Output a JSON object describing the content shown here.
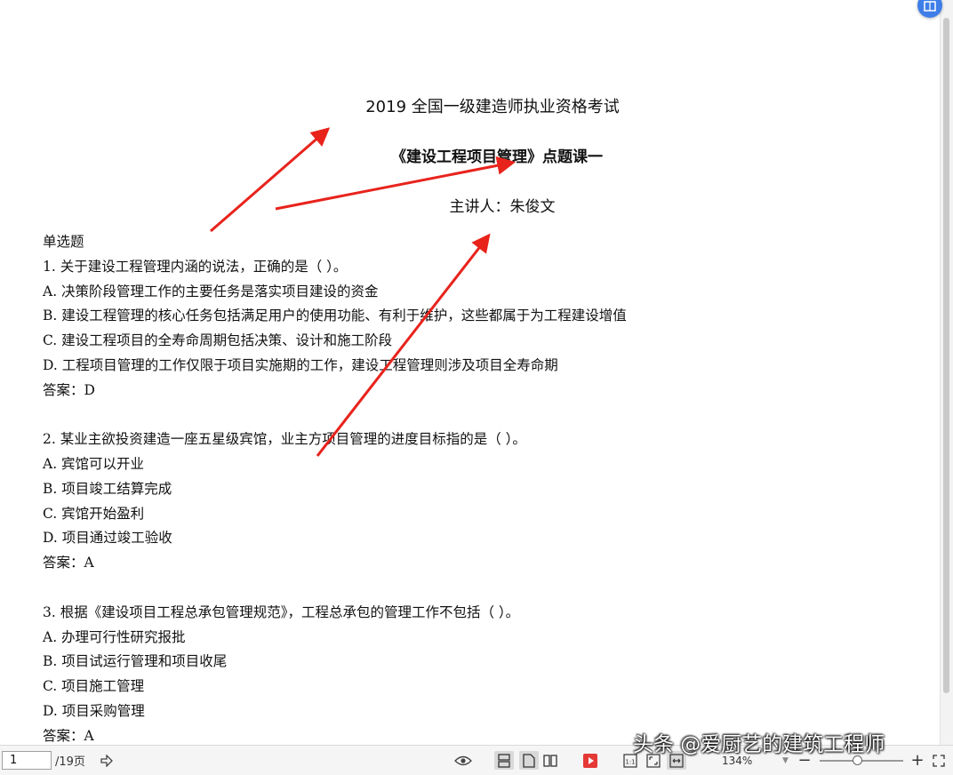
{
  "document": {
    "title": "2019 全国一级建造师执业资格考试",
    "subtitle": "《建设工程项目管理》点题课一",
    "lecturer": "主讲人：朱俊文",
    "section": "单选题",
    "questions": [
      {
        "stem": "1. 关于建设工程管理内涵的说法，正确的是（ ）。",
        "options": [
          "A. 决策阶段管理工作的主要任务是落实项目建设的资金",
          "B. 建设工程管理的核心任务包括满足用户的使用功能、有利于维护，这些都属于为工程建设增值",
          "C. 建设工程项目的全寿命周期包括决策、设计和施工阶段",
          "D. 工程项目管理的工作仅限于项目实施期的工作，建设工程管理则涉及项目全寿命期"
        ],
        "answer": "答案：D"
      },
      {
        "stem": "2. 某业主欲投资建造一座五星级宾馆，业主方项目管理的进度目标指的是（ ）。",
        "options": [
          "A. 宾馆可以开业",
          "B. 项目竣工结算完成",
          "C. 宾馆开始盈利",
          "D. 项目通过竣工验收"
        ],
        "answer": "答案：A"
      },
      {
        "stem": "3. 根据《建设项目工程总承包管理规范》，工程总承包的管理工作不包括（ ）。",
        "options": [
          "A. 办理可行性研究报批",
          "B. 项目试运行管理和项目收尾",
          "C. 项目施工管理",
          "D. 项目采购管理"
        ],
        "answer": "答案：A"
      }
    ]
  },
  "annotation_color": "#e8231c",
  "statusbar": {
    "current_page": "1",
    "total_pages": "/19页",
    "zoom": "134%",
    "zoom_fraction": 0.45
  },
  "icons": {
    "next": "arrow-right-icon",
    "eye": "eye-protection-icon",
    "play": "play-icon",
    "fullscreen": "fullscreen-icon"
  },
  "watermark": "头条 @爱厨艺的建筑工程师"
}
